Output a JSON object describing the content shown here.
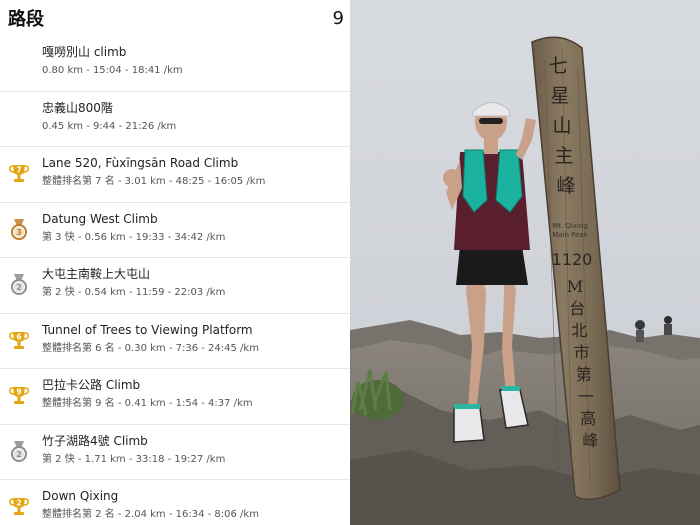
{
  "panel": {
    "title": "路段",
    "count": "9"
  },
  "segments": [
    {
      "name": "嘎嘮別山 climb",
      "meta": "0.80 km - 15:04 - 18:41 /km",
      "icon": "none",
      "badge": ""
    },
    {
      "name": "忠義山800階",
      "meta": "0.45 km - 9:44 - 21:26 /km",
      "icon": "none",
      "badge": ""
    },
    {
      "name": "Lane 520, Fùxīngsān Road Climb",
      "meta": "整體排名第 7 名 - 3.01 km - 48:25 - 16:05 /km",
      "icon": "trophy-icon",
      "badge": "7"
    },
    {
      "name": "Datung West Climb",
      "meta": "第 3 快 - 0.56 km - 19:33 - 34:42 /km",
      "icon": "bronze-medal-icon",
      "badge": "3"
    },
    {
      "name": "大屯主南鞍上大屯山",
      "meta": "第 2 快 - 0.54 km - 11:59 - 22:03 /km",
      "icon": "silver-medal-icon",
      "badge": "2"
    },
    {
      "name": "Tunnel of Trees to Viewing Platform",
      "meta": "整體排名第 6 名 - 0.30 km - 7:36 - 24:45 /km",
      "icon": "trophy-icon",
      "badge": "6"
    },
    {
      "name": "巴拉卡公路 Climb",
      "meta": "整體排名第 9 名 - 0.41 km - 1:54 - 4:37 /km",
      "icon": "trophy-icon",
      "badge": "9"
    },
    {
      "name": "竹子湖路4號 Climb",
      "meta": "第 2 快 - 1.71 km - 33:18 - 19:27 /km",
      "icon": "silver-medal-icon",
      "badge": "2"
    },
    {
      "name": "Down Qixing",
      "meta": "整體排名第 2 名 - 2.04 km - 16:34 - 8:06 /km",
      "icon": "trophy-icon",
      "badge": "2"
    }
  ],
  "photo": {
    "post_text": [
      "七",
      "星",
      "山",
      "主",
      "峰"
    ],
    "post_english": [
      "Mt. Qixing",
      "Main Peak"
    ],
    "post_elevation": "1120",
    "post_lower": [
      "M",
      "台",
      "北",
      "市",
      "第",
      "一",
      "高",
      "峰"
    ]
  },
  "colors": {
    "gold": "#e3a612",
    "bronze": "#c47a2a",
    "silver": "#8d8d8d",
    "divider": "#e6e6e6"
  }
}
